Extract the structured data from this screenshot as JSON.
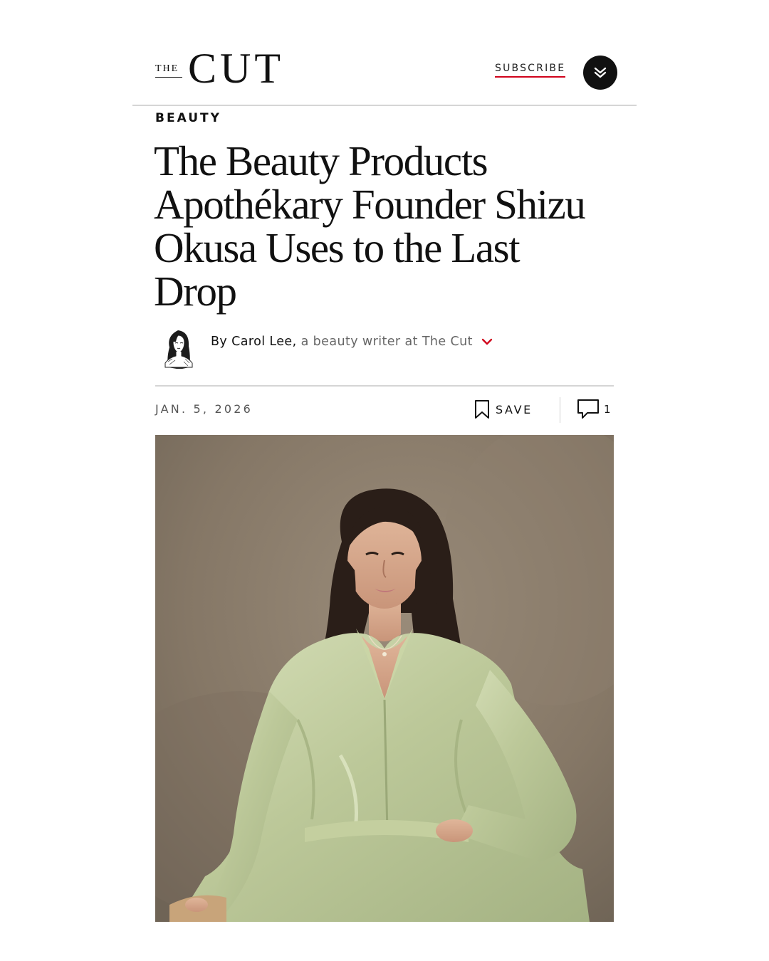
{
  "header": {
    "logo_the": "THE",
    "logo_cut": "CUT",
    "subscribe_label": "SUBSCRIBE",
    "menu_icon": "double-chevron-down-icon",
    "accent_color": "#d0021b"
  },
  "article": {
    "rubric": "BEAUTY",
    "headline": "The Beauty Products Apothékary Founder Shizu Okusa Uses to the Last Drop",
    "byline": {
      "prefix": "By",
      "author": "Carol Lee,",
      "role": "a beauty writer at The Cut",
      "expand_icon": "chevron-down-icon"
    },
    "date": "JAN. 5, 2026",
    "save_label": "SAVE",
    "comment_count": "1"
  },
  "media": {
    "lead_image": "portrait-photo"
  }
}
